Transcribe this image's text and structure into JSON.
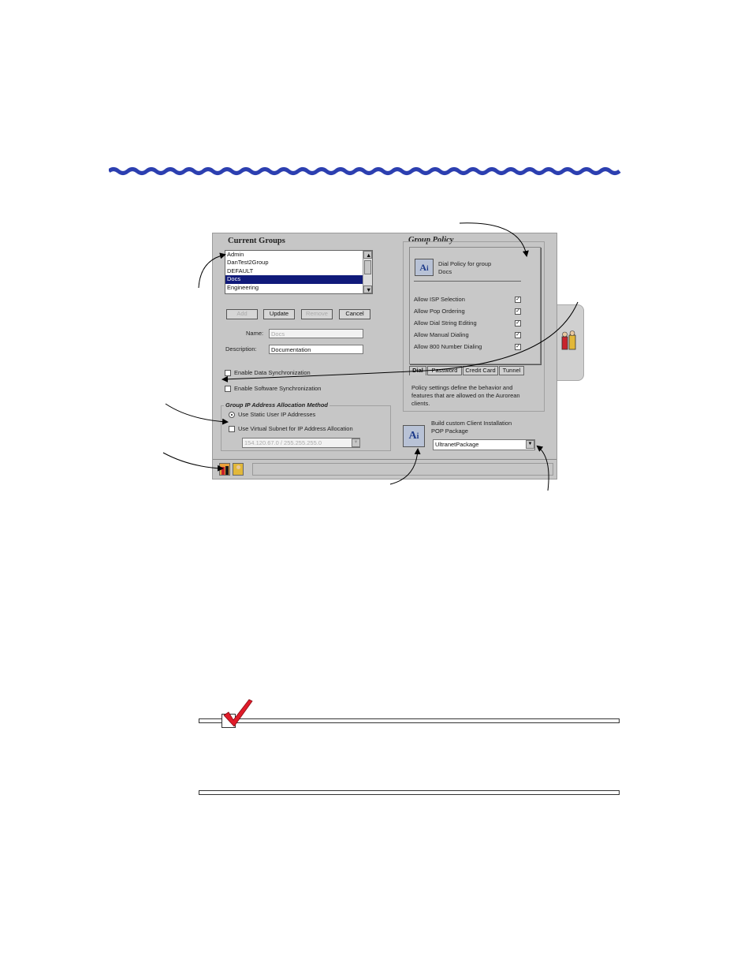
{
  "current_groups": {
    "header": "Current Groups",
    "items": [
      "Admin",
      "DanTest2Group",
      "DEFAULT",
      "Docs",
      "Engineering"
    ],
    "selected": "Docs"
  },
  "buttons": {
    "add": "Add",
    "update": "Update",
    "remove": "Remove",
    "cancel": "Cancel"
  },
  "fields": {
    "name_label": "Name:",
    "name_value": "Docs",
    "description_label": "Description:",
    "description_value": "Documentation"
  },
  "sync": {
    "data": "Enable Data Synchronization",
    "software": "Enable Software Synchronization"
  },
  "ip_allocation": {
    "header": "Group IP Address Allocation Method",
    "static": "Use Static User IP Addresses",
    "virtual": "Use Virtual Subnet for IP Address Allocation",
    "subnet_value": "154.120.67.0 / 255.255.255.0"
  },
  "group_policy": {
    "header": "Group Policy",
    "panel_title_line1": "Dial Policy for group",
    "panel_title_line2": "Docs",
    "options": [
      {
        "label": "Allow ISP Selection",
        "checked": true
      },
      {
        "label": "Allow Pop Ordering",
        "checked": true
      },
      {
        "label": "Allow Dial String Editing",
        "checked": true
      },
      {
        "label": "Allow Manual Dialing",
        "checked": true
      },
      {
        "label": "Allow 800 Number Dialing",
        "checked": true
      }
    ],
    "tabs": [
      "Dial",
      "Password",
      "Credit Card",
      "Tunnel"
    ],
    "active_tab": "Dial",
    "description_line1": "Policy settings define the behavior and",
    "description_line2": "features that are allowed on the Aurorean",
    "description_line3": "clients."
  },
  "build": {
    "label_line1": "Build custom Client Installation",
    "label_line2": "POP Package",
    "package_value": "UltranetPackage"
  },
  "icons": {
    "policy_icon": "ai-policy-icon",
    "build_icon": "ai-build-icon",
    "groups_tab_icon": "groups-icon",
    "users_tab_icon": "user-icon",
    "side_tab_icon": "groups-side-icon",
    "note_icon": "checkmark-icon"
  },
  "colors": {
    "wave": "#2c3fb0",
    "selection": "#101a7a",
    "checkmark": "#e01c2a",
    "dialog_bg": "#c6c6c6"
  }
}
